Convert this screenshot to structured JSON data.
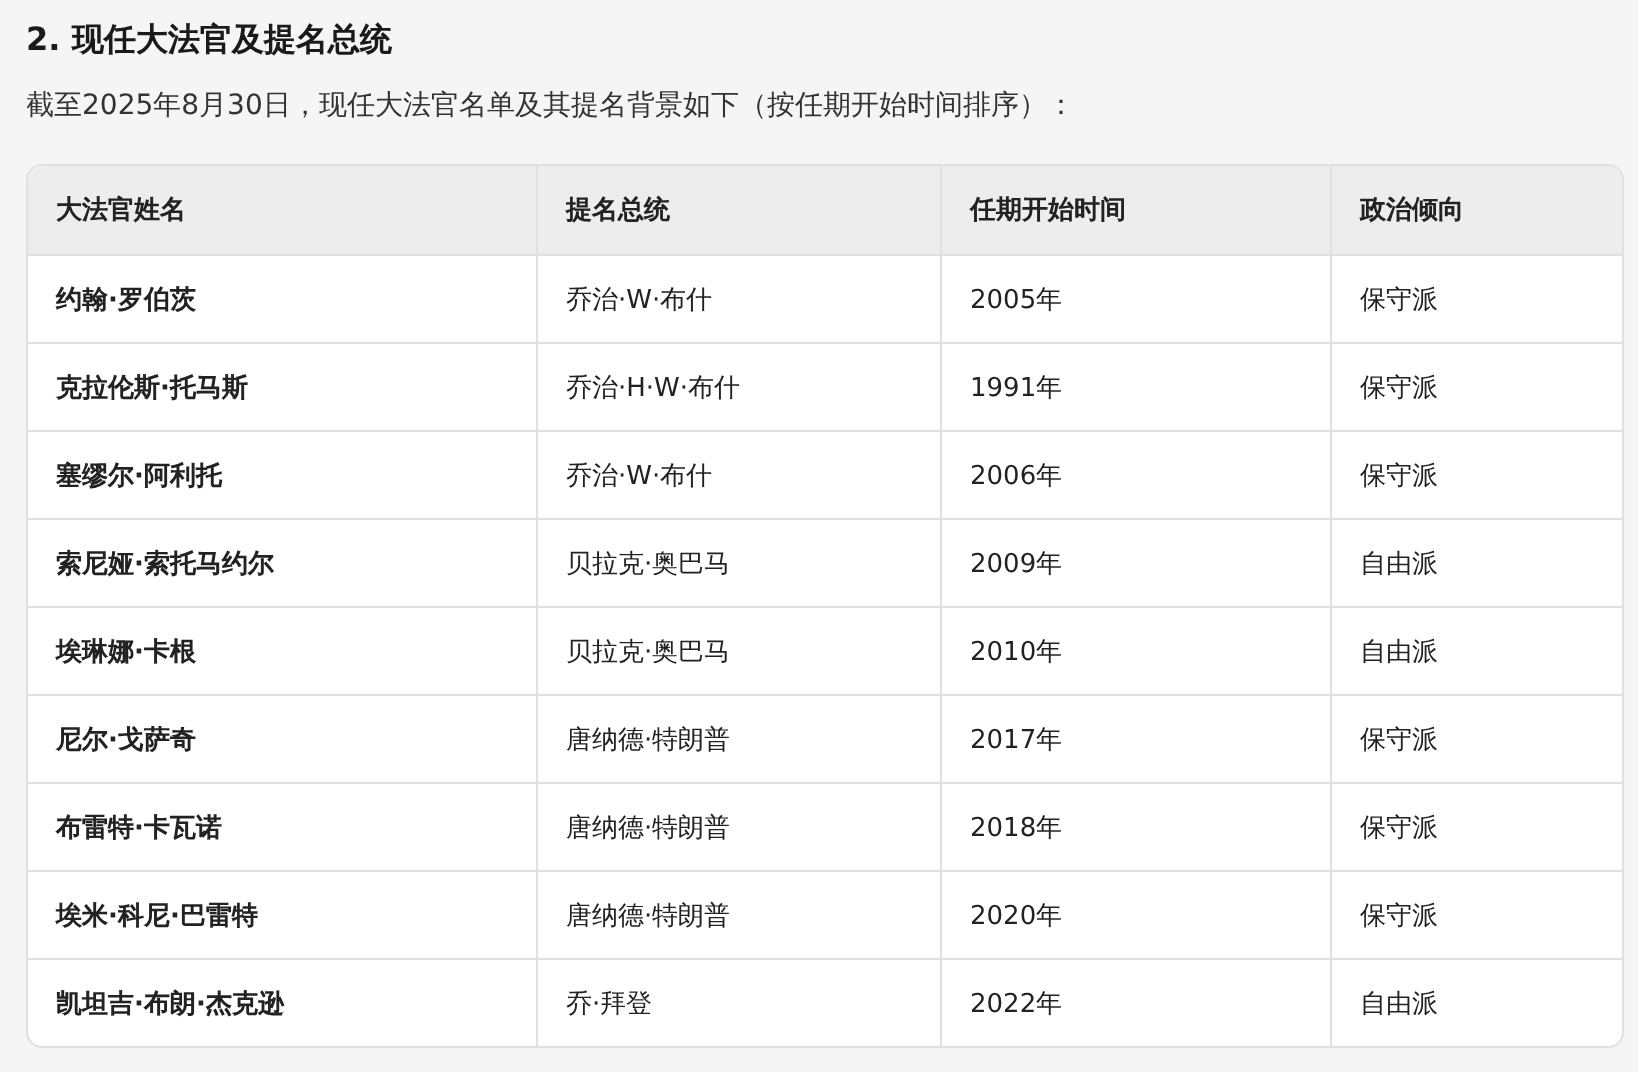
{
  "section": {
    "title": "2. 现任大法官及提名总统",
    "intro": "截至2025年8月30日，现任大法官名单及其提名背景如下（按任期开始时间排序）："
  },
  "table": {
    "columns": [
      "大法官姓名",
      "提名总统",
      "任期开始时间",
      "政治倾向"
    ],
    "rows": [
      [
        "约翰·罗伯茨",
        "乔治·W·布什",
        "2005年",
        "保守派"
      ],
      [
        "克拉伦斯·托马斯",
        "乔治·H·W·布什",
        "1991年",
        "保守派"
      ],
      [
        "塞缪尔·阿利托",
        "乔治·W·布什",
        "2006年",
        "保守派"
      ],
      [
        "索尼娅·索托马约尔",
        "贝拉克·奥巴马",
        "2009年",
        "自由派"
      ],
      [
        "埃琳娜·卡根",
        "贝拉克·奥巴马",
        "2010年",
        "自由派"
      ],
      [
        "尼尔·戈萨奇",
        "唐纳德·特朗普",
        "2017年",
        "保守派"
      ],
      [
        "布雷特·卡瓦诺",
        "唐纳德·特朗普",
        "2018年",
        "保守派"
      ],
      [
        "埃米·科尼·巴雷特",
        "唐纳德·特朗普",
        "2020年",
        "保守派"
      ],
      [
        "凯坦吉·布朗·杰克逊",
        "乔·拜登",
        "2022年",
        "自由派"
      ]
    ]
  }
}
